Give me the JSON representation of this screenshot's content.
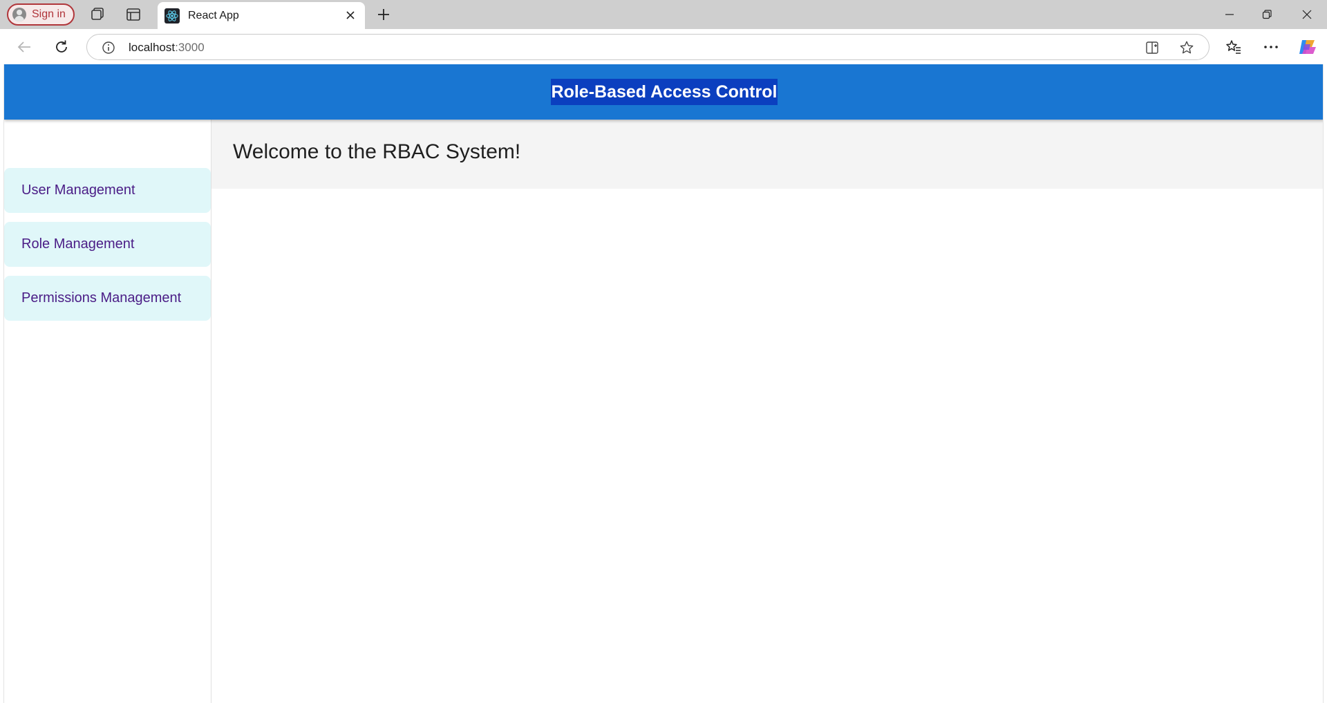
{
  "browser": {
    "sign_in_label": "Sign in",
    "tab_title": "React App",
    "url_host": "localhost",
    "url_port": ":3000",
    "icons": {
      "workspaces": "workspaces-icon",
      "tab_actions": "tab-actions-icon",
      "favicon": "react-logo-icon",
      "tab_close": "close-icon",
      "new_tab": "plus-icon",
      "back": "back-arrow-icon",
      "refresh": "refresh-icon",
      "site_info": "info-icon",
      "split_screen": "split-screen-icon",
      "favorite": "star-icon",
      "favorites": "favorites-icon",
      "more": "more-icon",
      "copilot": "copilot-icon"
    }
  },
  "app": {
    "header_title": "Role-Based Access Control",
    "sidebar": {
      "items": [
        {
          "label": "User Management"
        },
        {
          "label": "Role Management"
        },
        {
          "label": "Permissions Management"
        }
      ]
    },
    "main": {
      "welcome": "Welcome to the RBAC System!"
    }
  },
  "colors": {
    "appbar": "#1976d2",
    "title_highlight": "#0b3fbf",
    "nav_item_bg": "#e0f7f9",
    "nav_item_text": "#4a1c86",
    "welcome_panel_bg": "#f4f4f4"
  }
}
